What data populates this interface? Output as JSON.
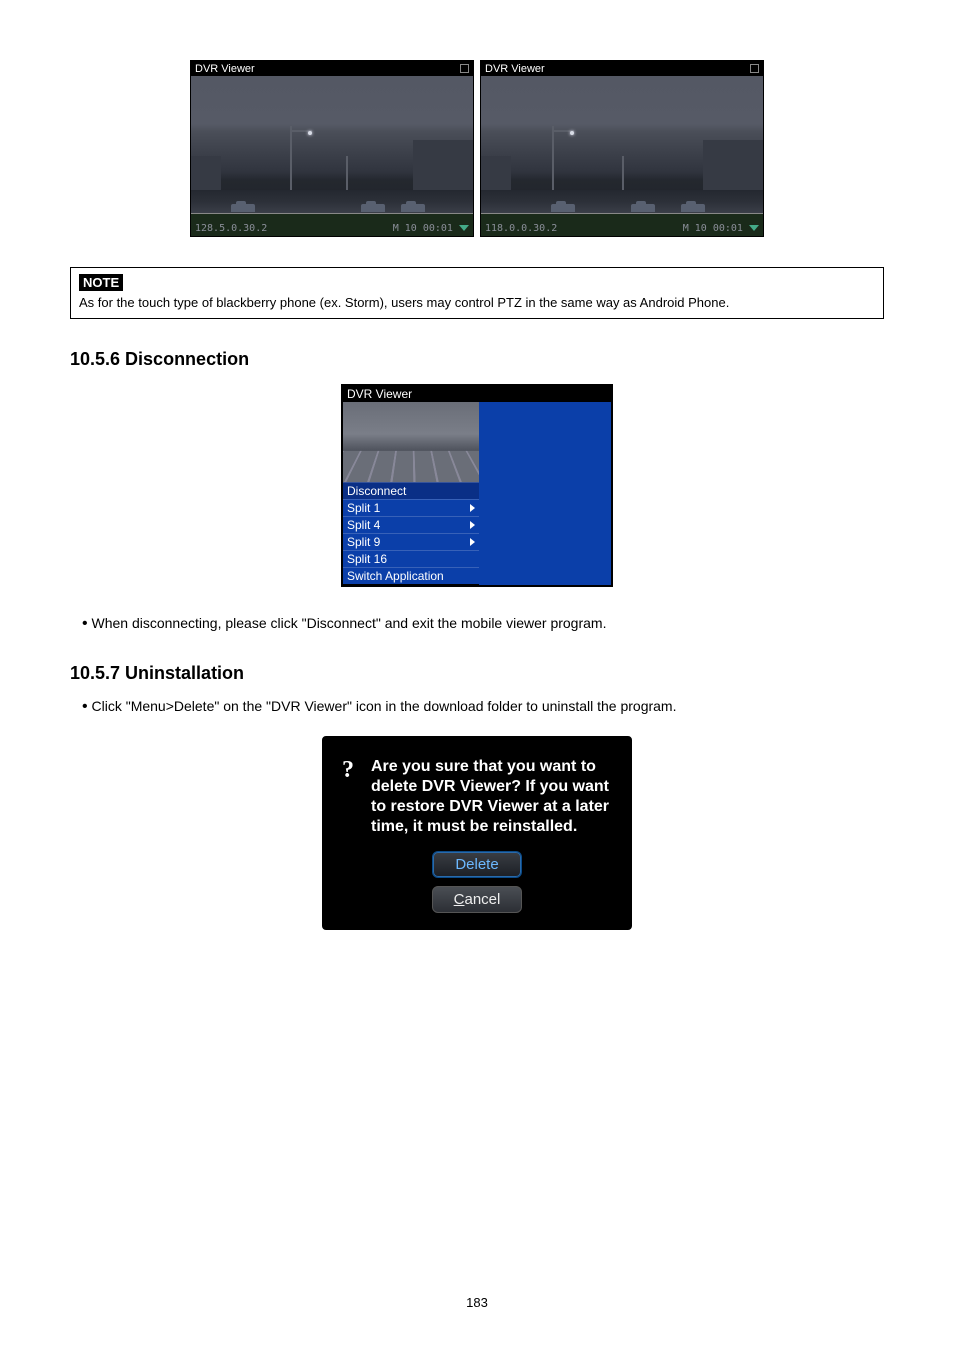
{
  "dvr_pair": {
    "title": "DVR Viewer",
    "left_ip": "128.5.0.30.2",
    "left_time": "M 10  00:01",
    "right_ip": "118.0.0.30.2",
    "right_time": "M 10  00:01"
  },
  "note": {
    "label": "NOTE",
    "text": "As for the touch type of blackberry phone (ex. Storm), users may control PTZ in the same way as Android Phone."
  },
  "sec1": {
    "heading": "10.5.6  Disconnection",
    "menu": {
      "title": "DVR Viewer",
      "items": [
        {
          "label": "Disconnect",
          "arrow": false,
          "highlight": true
        },
        {
          "label": "Split 1",
          "arrow": true,
          "highlight": false
        },
        {
          "label": "Split 4",
          "arrow": true,
          "highlight": false
        },
        {
          "label": "Split 9",
          "arrow": true,
          "highlight": false
        },
        {
          "label": "Split 16",
          "arrow": false,
          "highlight": false
        },
        {
          "label": "Switch Application",
          "arrow": false,
          "highlight": false
        }
      ]
    },
    "bullet": "When disconnecting, please click \"Disconnect\" and exit the mobile viewer program."
  },
  "sec2": {
    "heading": "10.5.7  Uninstallation",
    "bullet": "Click \"Menu>Delete\" on the \"DVR Viewer\" icon in the download folder to uninstall the program.",
    "dialog": {
      "text": "Are you sure that you want to delete DVR Viewer? If you want to restore DVR Viewer at a later time, it must be reinstalled.",
      "delete": "Delete",
      "cancel_prefix": "C",
      "cancel_rest": "ancel"
    }
  },
  "page_number": "183"
}
